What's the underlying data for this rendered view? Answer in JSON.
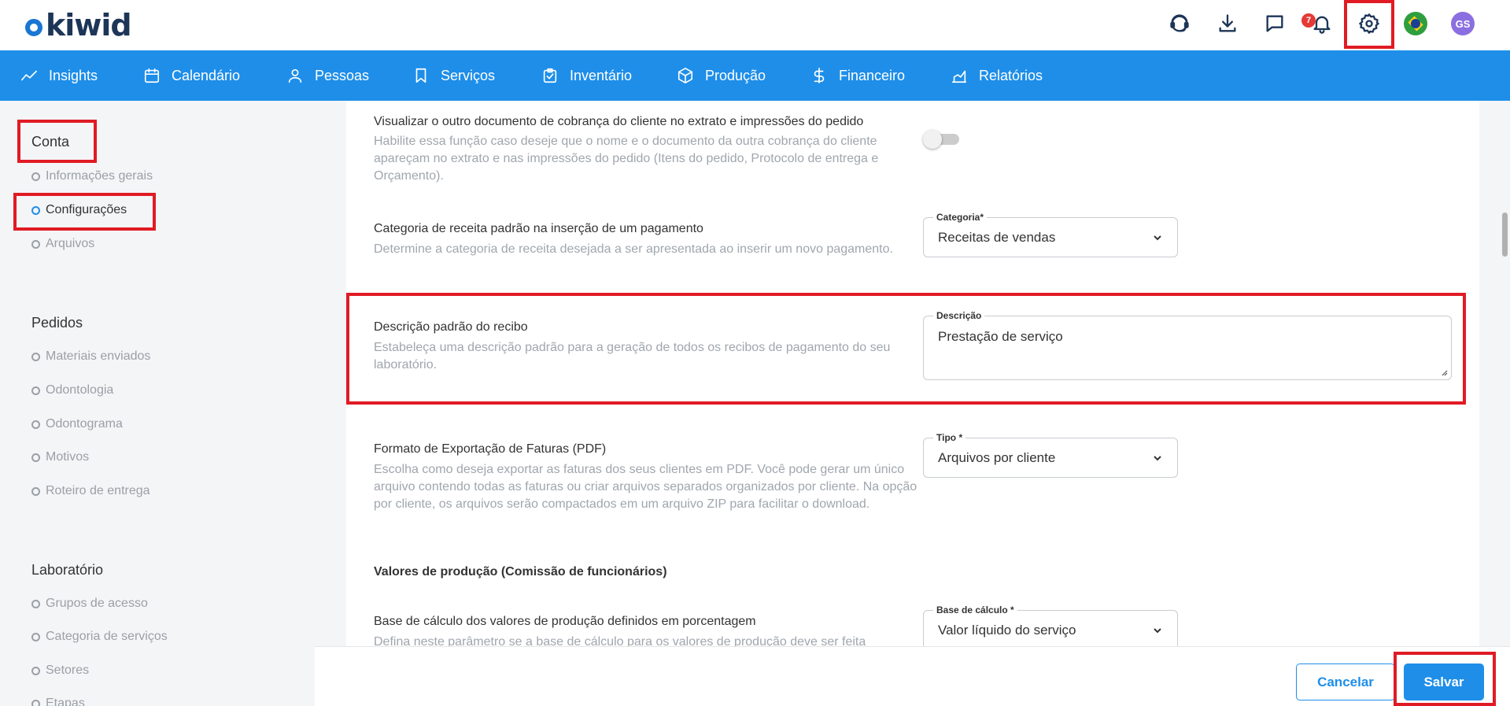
{
  "brand": {
    "logo_text": "kiwid"
  },
  "header": {
    "notification_count": "7",
    "avatar_initials": "GS",
    "icons": [
      "support-icon",
      "download-icon",
      "chat-icon",
      "bell-icon",
      "gear-icon",
      "brazil-flag-icon"
    ]
  },
  "nav": {
    "items": [
      {
        "label": "Insights",
        "icon": "chart-line-icon"
      },
      {
        "label": "Calendário",
        "icon": "calendar-icon"
      },
      {
        "label": "Pessoas",
        "icon": "person-icon"
      },
      {
        "label": "Serviços",
        "icon": "bookmark-icon"
      },
      {
        "label": "Inventário",
        "icon": "clipboard-icon"
      },
      {
        "label": "Produção",
        "icon": "box-icon"
      },
      {
        "label": "Financeiro",
        "icon": "dollar-icon"
      },
      {
        "label": "Relatórios",
        "icon": "report-icon"
      }
    ]
  },
  "sidebar": {
    "sections": [
      {
        "title": "Conta",
        "items": [
          "Informações gerais",
          "Configurações",
          "Arquivos"
        ]
      },
      {
        "title": "Pedidos",
        "items": [
          "Materiais enviados",
          "Odontologia",
          "Odontograma",
          "Motivos",
          "Roteiro de entrega"
        ]
      },
      {
        "title": "Laboratório",
        "items": [
          "Grupos de acesso",
          "Categoria de serviços",
          "Setores",
          "Etapas"
        ]
      }
    ],
    "active_item": "Configurações"
  },
  "settings": {
    "other_doc": {
      "title": "Visualizar o outro documento de cobrança do cliente no extrato e impressões do pedido",
      "desc": "Habilite essa função caso deseje que o nome e o documento da outra cobrança do cliente apareçam no extrato e nas impressões do pedido (Itens do pedido, Protocolo de entrega e Orçamento).",
      "enabled": false
    },
    "revenue_category": {
      "title": "Categoria de receita padrão na inserção de um pagamento",
      "desc": "Determine a categoria de receita desejada a ser apresentada ao inserir um novo pagamento.",
      "field_label": "Categoria*",
      "value": "Receitas de vendas"
    },
    "receipt_desc": {
      "title": "Descrição padrão do recibo",
      "desc": "Estabeleça uma descrição padrão para a geração de todos os recibos de pagamento do seu laboratório.",
      "field_label": "Descrição",
      "value": "Prestação de serviço"
    },
    "invoice_export": {
      "title": "Formato de Exportação de Faturas (PDF)",
      "desc": "Escolha como deseja exportar as faturas dos seus clientes em PDF. Você pode gerar um único arquivo contendo todas as faturas ou criar arquivos separados organizados por cliente. Na opção por cliente, os arquivos serão compactados em um arquivo ZIP para facilitar o download.",
      "field_label": "Tipo *",
      "value": "Arquivos por cliente"
    },
    "production_section": "Valores de produção (Comissão de funcionários)",
    "calc_base": {
      "title": "Base de cálculo dos valores de produção definidos em porcentagem",
      "desc": "Defina neste parâmetro se a base de cálculo para os valores de produção deve ser feita",
      "field_label": "Base de cálculo *",
      "value": "Valor líquido do serviço"
    }
  },
  "footer": {
    "cancel_label": "Cancelar",
    "save_label": "Salvar"
  },
  "colors": {
    "primary": "#1e8ee9",
    "highlight": "#e01b24",
    "navy": "#1d3557"
  }
}
